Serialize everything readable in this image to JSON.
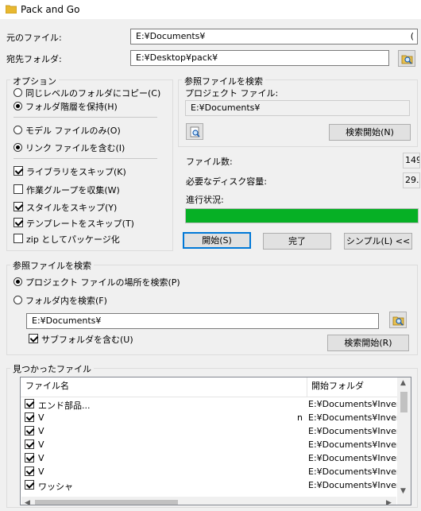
{
  "window": {
    "title": "Pack and Go"
  },
  "source": {
    "label": "元のファイル:",
    "value": "E:¥Documents¥",
    "value_tail": "("
  },
  "destination": {
    "label": "宛先フォルダ:",
    "value": "E:¥Desktop¥pack¥"
  },
  "options": {
    "title": "オプション",
    "copy_same_level": "同じレベルのフォルダにコピー(C)",
    "keep_hierarchy": "フォルダ階層を保持(H)",
    "model_only": "モデル ファイルのみ(O)",
    "include_links": "リンク ファイルを含む(I)",
    "skip_libraries": "ライブラリをスキップ(K)",
    "collect_workgroups": "作業グループを収集(W)",
    "skip_styles": "スタイルをスキップ(Y)",
    "skip_templates": "テンプレートをスキップ(T)",
    "zip_package": "zip としてパッケージ化"
  },
  "ref_search_top": {
    "title": "参照ファイルを検索",
    "project_label": "プロジェクト ファイル:",
    "project_value": "E:¥Documents¥",
    "start_label": "検索開始(N)"
  },
  "stats": {
    "file_count_label": "ファイル数:",
    "file_count_value": "149",
    "disk_label": "必要なディスク容量:",
    "disk_value": "29.",
    "progress_label": "進行状況:",
    "progress_fraction": 1.0
  },
  "actions": {
    "start": "開始(S)",
    "done": "完了",
    "simple": "シンプル(L) <<"
  },
  "ref_search_bottom": {
    "title": "参照ファイルを検索",
    "search_project_location": "プロジェクト ファイルの場所を検索(P)",
    "search_in_folder": "フォルダ内を検索(F)",
    "folder_value": "E:¥Documents¥",
    "include_subfolders": "サブフォルダを含む(U)",
    "start_label": "検索開始(R)"
  },
  "found_files": {
    "title": "見つかったファイル",
    "col_filename": "ファイル名",
    "col_start_folder": "開始フォルダ",
    "rows": [
      {
        "name": "エンド部品...",
        "folder": "E:¥Documents¥Inven"
      },
      {
        "name": "V",
        "folder": "E:¥Documents¥Inven",
        "tail": "n"
      },
      {
        "name": "V",
        "folder": "E:¥Documents¥Inven"
      },
      {
        "name": "V",
        "folder": "E:¥Documents¥Inven"
      },
      {
        "name": "V",
        "folder": "E:¥Documents¥Inven"
      },
      {
        "name": "V",
        "folder": "E:¥Documents¥Inven"
      },
      {
        "name": "ワッシャ",
        "folder": "E:¥Documents¥Inven"
      }
    ]
  }
}
